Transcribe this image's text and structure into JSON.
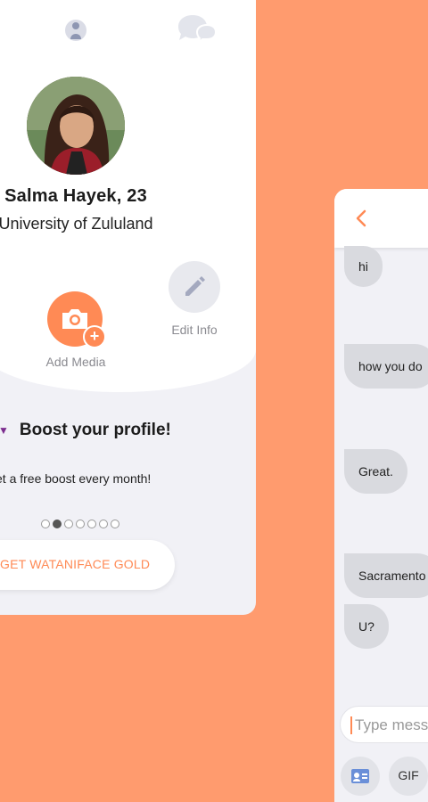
{
  "profile": {
    "name_age": "Salma Hayek, 23",
    "school": "University of Zululand",
    "add_media_label": "Add Media",
    "edit_info_label": "Edit Info",
    "plus_symbol": "+",
    "boost_arrow": "▼",
    "boost_title": "Boost your profile!",
    "boost_subtitle": "et a free boost every month!",
    "carousel": {
      "total": 7,
      "active_index": 1
    },
    "gold_button_label": "GET WATANIFACE GOLD"
  },
  "chat": {
    "messages": [
      {
        "text": "hi"
      },
      {
        "text": "how you do"
      },
      {
        "text": "Great."
      },
      {
        "text": "Sacramento"
      },
      {
        "text": "U?"
      }
    ],
    "input_placeholder": "Type mess",
    "gif_label": "GIF"
  },
  "colors": {
    "background": "#FF9B6E",
    "accent": "#FF8A55",
    "card": "#F1F1F6",
    "bubble": "#D9DADF",
    "boost_arrow": "#7B2D8E"
  },
  "icons": {
    "header_left": "person-icon",
    "header_right": "chat-bubbles-icon",
    "add_media": "camera-icon",
    "edit_info": "pencil-icon",
    "back": "chevron-left-icon",
    "contact": "contact-card-icon"
  }
}
